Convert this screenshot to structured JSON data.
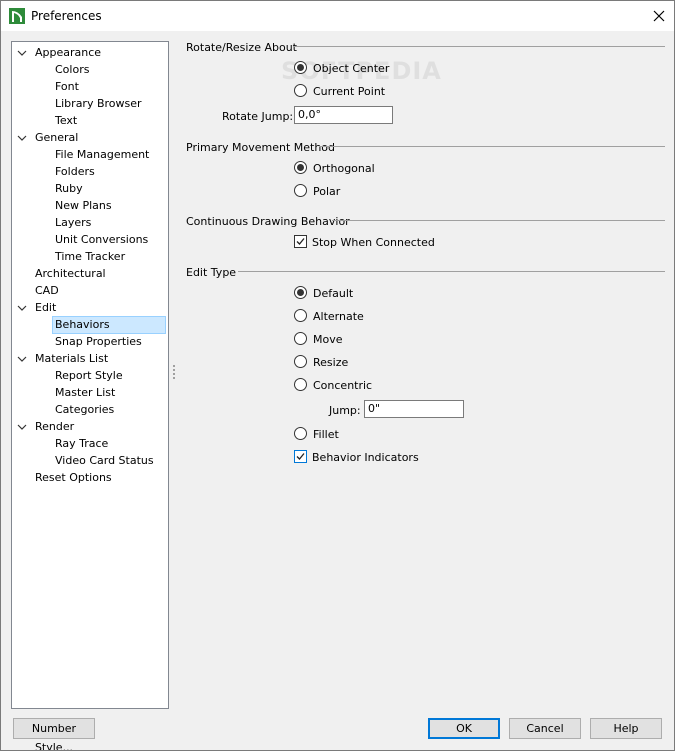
{
  "window": {
    "title": "Preferences"
  },
  "tree": {
    "items": [
      {
        "label": "Appearance",
        "level": 0,
        "expanded": true
      },
      {
        "label": "Colors",
        "level": 1
      },
      {
        "label": "Font",
        "level": 1
      },
      {
        "label": "Library Browser",
        "level": 1
      },
      {
        "label": "Text",
        "level": 1
      },
      {
        "label": "General",
        "level": 0,
        "expanded": true
      },
      {
        "label": "File Management",
        "level": 1
      },
      {
        "label": "Folders",
        "level": 1
      },
      {
        "label": "Ruby",
        "level": 1
      },
      {
        "label": "New Plans",
        "level": 1
      },
      {
        "label": "Layers",
        "level": 1
      },
      {
        "label": "Unit Conversions",
        "level": 1
      },
      {
        "label": "Time Tracker",
        "level": 1
      },
      {
        "label": "Architectural",
        "level": 0
      },
      {
        "label": "CAD",
        "level": 0
      },
      {
        "label": "Edit",
        "level": 0,
        "expanded": true
      },
      {
        "label": "Behaviors",
        "level": 1,
        "selected": true
      },
      {
        "label": "Snap Properties",
        "level": 1
      },
      {
        "label": "Materials List",
        "level": 0,
        "expanded": true
      },
      {
        "label": "Report Style",
        "level": 1
      },
      {
        "label": "Master List",
        "level": 1
      },
      {
        "label": "Categories",
        "level": 1
      },
      {
        "label": "Render",
        "level": 0,
        "expanded": true
      },
      {
        "label": "Ray Trace",
        "level": 1
      },
      {
        "label": "Video Card Status",
        "level": 1
      },
      {
        "label": "Reset Options",
        "level": 0
      }
    ]
  },
  "rotate": {
    "heading": "Rotate/Resize About",
    "options": [
      {
        "label": "Object Center",
        "checked": true
      },
      {
        "label": "Current Point",
        "checked": false
      }
    ],
    "jump_label": "Rotate Jump:",
    "jump_value": "0,0°"
  },
  "movement": {
    "heading": "Primary Movement Method",
    "options": [
      {
        "label": "Orthogonal",
        "checked": true
      },
      {
        "label": "Polar",
        "checked": false
      }
    ]
  },
  "continuous": {
    "heading": "Continuous Drawing Behavior",
    "stop_label": "Stop When Connected",
    "stop_checked": true
  },
  "edit_type": {
    "heading": "Edit Type",
    "options": [
      {
        "label": "Default",
        "checked": true
      },
      {
        "label": "Alternate",
        "checked": false
      },
      {
        "label": "Move",
        "checked": false
      },
      {
        "label": "Resize",
        "checked": false
      },
      {
        "label": "Concentric",
        "checked": false
      }
    ],
    "jump_label": "Jump:",
    "jump_value": "0\"",
    "fillet_label": "Fillet",
    "fillet_checked": false,
    "indicators_label": "Behavior Indicators",
    "indicators_checked": true
  },
  "buttons": {
    "number_style": "Number Style...",
    "ok": "OK",
    "cancel": "Cancel",
    "help": "Help"
  },
  "watermark": "SOFTPEDIA",
  "colors": {
    "accent": "#0078d7",
    "selection": "#cce8ff",
    "logo_green": "#2e8b3a"
  }
}
